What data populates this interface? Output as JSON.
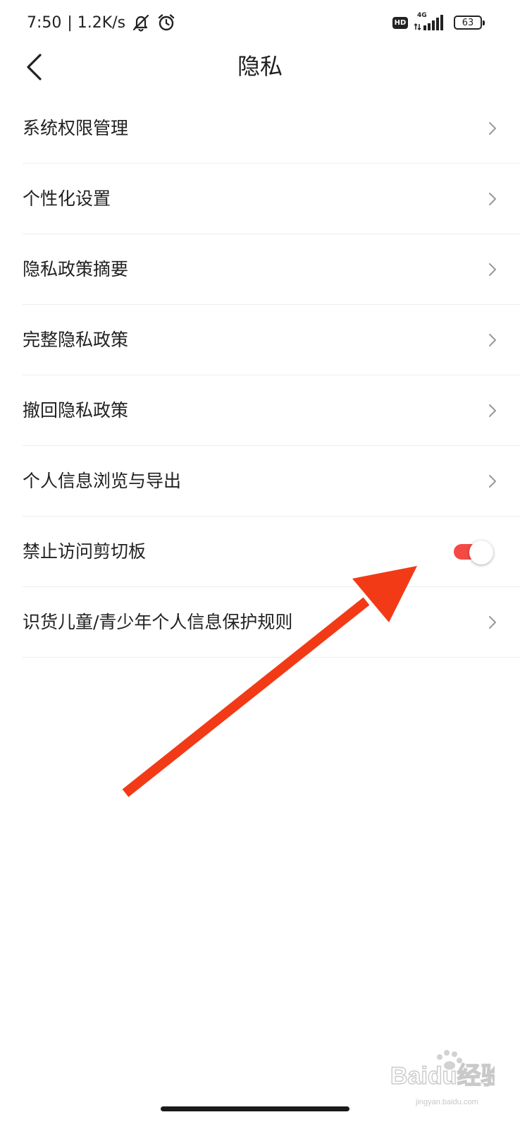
{
  "status_bar": {
    "time": "7:50",
    "net_speed": "| 1.2K/s",
    "hd_badge": "HD",
    "network": "4G",
    "battery": "63"
  },
  "header": {
    "title": "隐私"
  },
  "settings": {
    "items": [
      {
        "label": "系统权限管理"
      },
      {
        "label": "个性化设置"
      },
      {
        "label": "隐私政策摘要"
      },
      {
        "label": "完整隐私政策"
      },
      {
        "label": "撤回隐私政策"
      },
      {
        "label": "个人信息浏览与导出"
      },
      {
        "label": "禁止访问剪切板",
        "toggle_on": true
      },
      {
        "label": "识货儿童/青少年个人信息保护规则"
      }
    ]
  },
  "colors": {
    "toggle_on": "#f34a45",
    "annotation_arrow": "#f23a17"
  },
  "watermark": {
    "text": "Baidu经验",
    "sub": "jingyan.baidu.com"
  }
}
